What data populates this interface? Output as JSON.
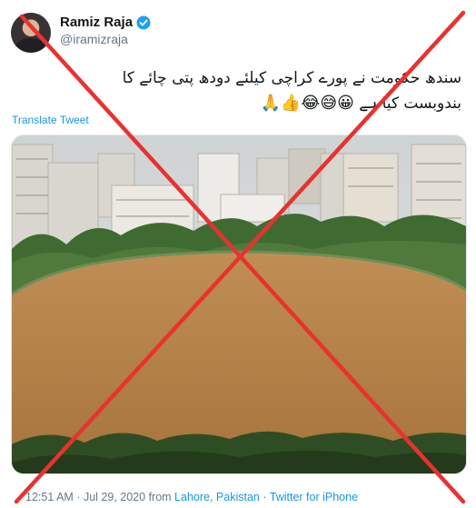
{
  "author": {
    "name": "Ramiz Raja",
    "handle": "@iramizraja",
    "verified_icon": "verified-badge-icon"
  },
  "tweet": {
    "text_line1": "سندھ حکومت نے پورے کراچی کیلئے دودھ پتی چائے کا",
    "text_line2": "بندوبست کیا ہے",
    "emojis": "😀😅😂👍🙏",
    "translate_label": "Translate Tweet"
  },
  "meta": {
    "time": "12:51 AM",
    "separator": "·",
    "date": "Jul 29, 2020",
    "from_label": "from",
    "location": "Lahore, Pakistan",
    "source": "Twitter for iPhone"
  },
  "overlay": {
    "icon": "red-x-cross-icon",
    "color": "#e8322f"
  },
  "colors": {
    "accent": "#1b95e0",
    "muted": "#657786",
    "water": "#b7844b"
  }
}
